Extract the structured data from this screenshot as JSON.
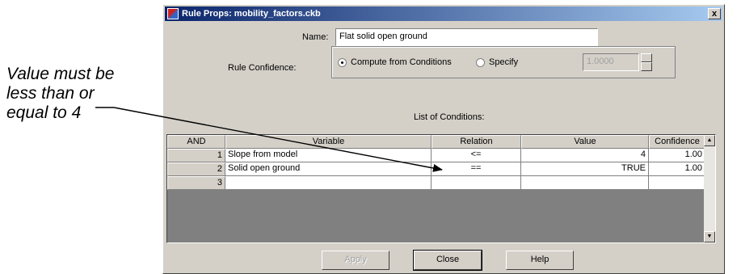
{
  "callout": {
    "lines": [
      "Value must be",
      "less than or",
      "equal to 4"
    ]
  },
  "window": {
    "title": "Rule Props: mobility_factors.ckb",
    "close_glyph": "x"
  },
  "form": {
    "name_label": "Name:",
    "name_value": "Flat solid open ground",
    "confidence_label": "Rule Confidence:",
    "radio_compute": "Compute from Conditions",
    "radio_specify": "Specify",
    "selected": "compute",
    "specify_value": "1.0000",
    "list_label": "List of Conditions:"
  },
  "table": {
    "headers": [
      "AND",
      "Variable",
      "Relation",
      "Value",
      "Confidence"
    ],
    "rows": [
      {
        "num": "1",
        "variable": "Slope from model",
        "relation": "<=",
        "value": "4",
        "confidence": "1.00"
      },
      {
        "num": "2",
        "variable": "Solid open ground",
        "relation": "==",
        "value": "TRUE",
        "confidence": "1.00"
      },
      {
        "num": "3",
        "variable": "",
        "relation": "",
        "value": "",
        "confidence": ""
      }
    ]
  },
  "buttons": {
    "apply": "Apply",
    "close": "Close",
    "help": "Help"
  },
  "colors": {
    "titlebar_start": "#0a246a",
    "titlebar_end": "#a6caf0",
    "face": "#d4d0c8"
  }
}
